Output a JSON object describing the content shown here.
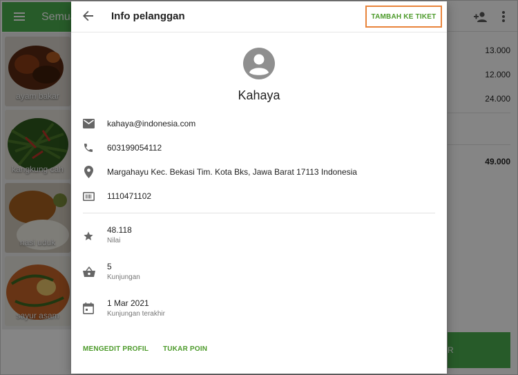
{
  "background": {
    "app_title": "Semua",
    "products": [
      {
        "label": "ayam bakar"
      },
      {
        "label": "kangkung cah"
      },
      {
        "label": "nasi uduk"
      },
      {
        "label": "sayur asam"
      }
    ],
    "ticket_prices": [
      "13.000",
      "12.000",
      "24.000"
    ],
    "ticket_total": "49.000",
    "charge_label_fragment": "R",
    "colors": {
      "primary": "#4caf50"
    }
  },
  "dialog": {
    "title": "Info pelanggan",
    "add_to_ticket_label": "TAMBAH KE TIKET",
    "customer_name": "Kahaya",
    "email": "kahaya@indonesia.com",
    "phone": "603199054112",
    "address": "Margahayu Kec. Bekasi Tim. Kota Bks, Jawa Barat 17113 Indonesia",
    "customer_code": "1110471102",
    "points": {
      "value": "48.118",
      "label": "Nilai"
    },
    "visits": {
      "value": "5",
      "label": "Kunjungan"
    },
    "last_visit": {
      "value": "1 Mar 2021",
      "label": "Kunjungan terakhir"
    },
    "edit_profile_label": "MENGEDIT PROFIL",
    "redeem_points_label": "TUKAR POIN",
    "colors": {
      "accent": "#4c9a2a",
      "highlight_border": "#e8833a"
    }
  }
}
